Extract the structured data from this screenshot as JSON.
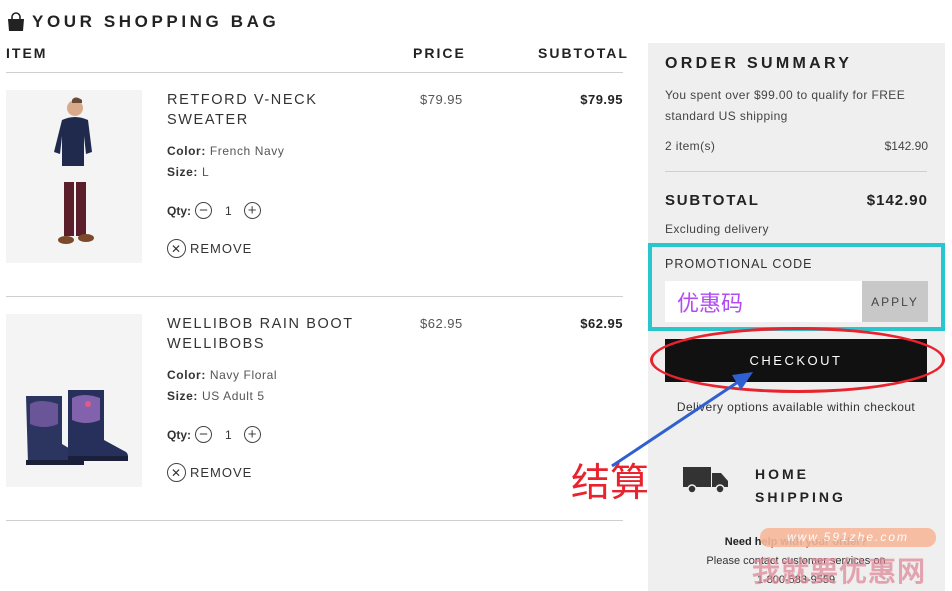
{
  "header": {
    "title": "YOUR SHOPPING BAG"
  },
  "columns": {
    "item": "ITEM",
    "price": "PRICE",
    "subtotal": "SUBTOTAL"
  },
  "items": [
    {
      "name": "RETFORD V-NECK SWEATER",
      "color_label": "Color:",
      "color": "French Navy",
      "size_label": "Size:",
      "size": "L",
      "qty_label": "Qty:",
      "qty": "1",
      "remove_label": "REMOVE",
      "price": "$79.95",
      "subtotal": "$79.95"
    },
    {
      "name": "WELLIBOB RAIN BOOT WELLIBOBS",
      "color_label": "Color:",
      "color": "Navy Floral",
      "size_label": "Size:",
      "size": "US Adult 5",
      "qty_label": "Qty:",
      "qty": "1",
      "remove_label": "REMOVE",
      "price": "$62.95",
      "subtotal": "$62.95"
    }
  ],
  "summary": {
    "title": "ORDER SUMMARY",
    "free_shipping_note": "You spent over $99.00 to qualify for FREE standard US shipping",
    "items_count": "2 item(s)",
    "items_total": "$142.90",
    "subtotal_label": "SUBTOTAL",
    "subtotal_value": "$142.90",
    "excluding_delivery": "Excluding delivery",
    "promo_label": "PROMOTIONAL CODE",
    "promo_value": "优惠码",
    "apply_label": "APPLY",
    "checkout_label": "CHECKOUT",
    "delivery_note": "Delivery options available within checkout",
    "shipping_line1": "HOME",
    "shipping_line2": "SHIPPING",
    "help_title": "Need help with your order?",
    "help_text": "Please contact customer services on",
    "help_phone": "1-800-583-9559"
  },
  "annotations": {
    "checkout_note": "结算",
    "color": "#e8232e",
    "promo_highlight_color": "#28c7cf",
    "arrow_color": "#2f5fd0"
  },
  "watermark": {
    "url": "www.591zhe.com",
    "text": "我就要优惠网"
  }
}
